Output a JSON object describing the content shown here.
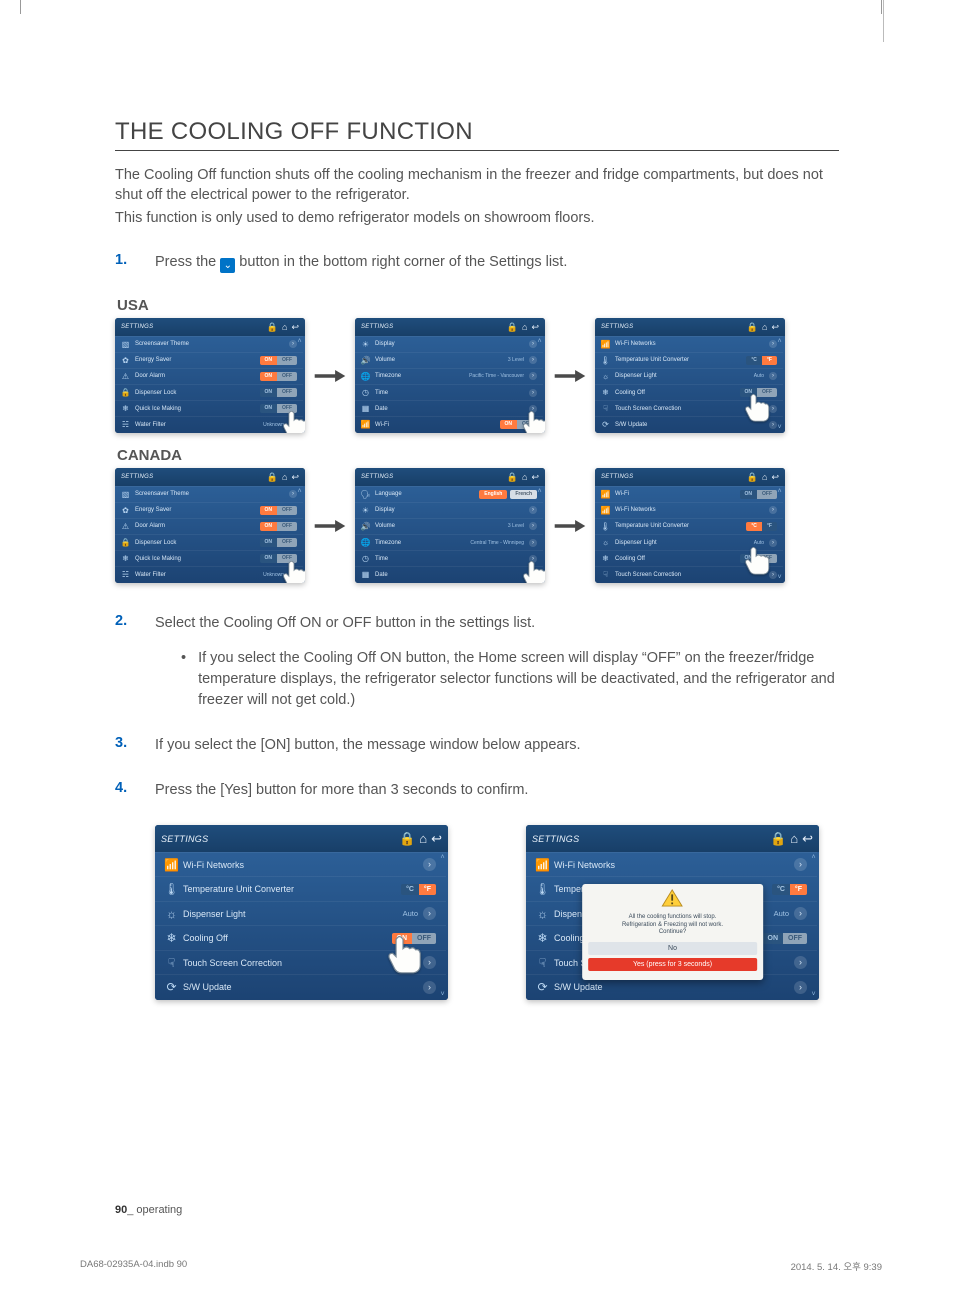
{
  "heading": "THE COOLING OFF FUNCTION",
  "intro_lines": [
    "The Cooling Off function shuts off the cooling mechanism in the freezer and fridge compartments, but does not shut off the electrical power to the refrigerator.",
    "This function is only used to demo refrigerator models on showroom floors."
  ],
  "steps": {
    "s1_num": "1.",
    "s1_a": "Press the ",
    "s1_b": " button in the bottom right corner of the Settings list.",
    "s2_num": "2.",
    "s2": "Select the Cooling Off ON or OFF button in the settings list.",
    "s2_bullet": "If you select the Cooling Off ON button, the Home screen will display “OFF” on the freezer/fridge temperature displays, the refrigerator selector functions will be deactivated, and the refrigerator and freezer will not get cold.)",
    "s3_num": "3.",
    "s3": "If you select the [ON] button, the message window below appears.",
    "s4_num": "4.",
    "s4": "Press the [Yes] button for more than 3 seconds to confirm."
  },
  "region_usa": "USA",
  "region_canada": "CANADA",
  "panel_shared": {
    "title": "SETTINGS",
    "on": "ON",
    "off": "OFF",
    "celsius": "°C",
    "fahrenheit": "°F",
    "auto": "Auto",
    "unknown": "Unknown",
    "english": "English",
    "french": "French",
    "level3": "3 Level",
    "tz_usa": "Pacific Time - Vancouver",
    "tz_can": "Central Time - Winnipeg"
  },
  "usa": {
    "p1": [
      "Screensaver Theme",
      "Energy Saver",
      "Door Alarm",
      "Dispenser Lock",
      "Quick Ice Making",
      "Water Filter"
    ],
    "p2": [
      "Display",
      "Volume",
      "Timezone",
      "Time",
      "Date",
      "Wi-Fi"
    ],
    "p3": [
      "Wi-Fi Networks",
      "Temperature Unit Converter",
      "Dispenser Light",
      "Cooling Off",
      "Touch Screen Correction",
      "S/W Update"
    ]
  },
  "canada": {
    "p1": [
      "Screensaver Theme",
      "Energy Saver",
      "Door Alarm",
      "Dispenser Lock",
      "Quick Ice Making",
      "Water Filter"
    ],
    "p2": [
      "Language",
      "Display",
      "Volume",
      "Timezone",
      "Time",
      "Date"
    ],
    "p3": [
      "Wi-Fi",
      "Wi-Fi Networks",
      "Temperature Unit Converter",
      "Dispenser Light",
      "Cooling Off",
      "Touch Screen Correction"
    ]
  },
  "large_panel": {
    "rows": [
      "Wi-Fi Networks",
      "Temperature Unit Converter",
      "Dispenser Light",
      "Cooling Off",
      "Touch Screen Correction",
      "S/W Update"
    ]
  },
  "modal": {
    "line1": "All the cooling functions will stop.",
    "line2": "Refrigeration & Freezing will not work.",
    "line3": "Continue?",
    "no": "No",
    "yes": "Yes (press for 3 seconds)"
  },
  "footer_page": "90",
  "footer_section": "_ operating",
  "printfoot_left": "DA68-02935A-04.indb   90",
  "printfoot_right": "2014. 5. 14.   오후 9:39"
}
